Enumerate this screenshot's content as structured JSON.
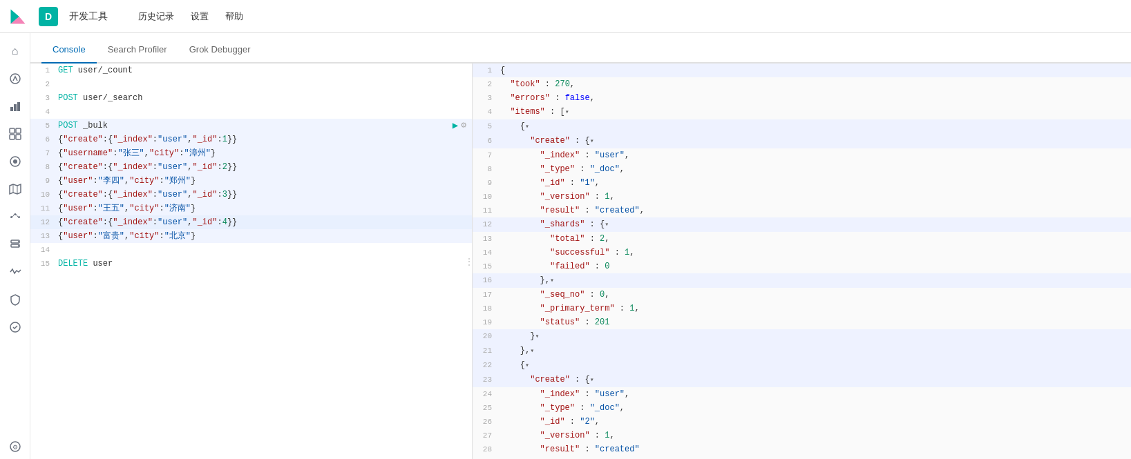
{
  "topbar": {
    "logo_text": "K",
    "app_icon": "D",
    "app_title": "开发工具"
  },
  "nav": {
    "items": [
      "历史记录",
      "设置",
      "帮助"
    ]
  },
  "tabs": {
    "items": [
      "Console",
      "Search Profiler",
      "Grok Debugger"
    ],
    "active": 0
  },
  "sidebar": {
    "icons": [
      {
        "name": "home-icon",
        "symbol": "⌂"
      },
      {
        "name": "bar-chart-icon",
        "symbol": "▦"
      },
      {
        "name": "stack-icon",
        "symbol": "⊞"
      },
      {
        "name": "box-icon",
        "symbol": "⬡"
      },
      {
        "name": "person-icon",
        "symbol": "👤"
      },
      {
        "name": "nodes-icon",
        "symbol": "⬡"
      },
      {
        "name": "alert-icon",
        "symbol": "🔔"
      },
      {
        "name": "wrench-icon",
        "symbol": "🔧"
      },
      {
        "name": "refresh-icon",
        "symbol": "↺"
      },
      {
        "name": "lock-icon",
        "symbol": "🔒"
      },
      {
        "name": "heart-icon",
        "symbol": "♡"
      },
      {
        "name": "settings-icon",
        "symbol": "⚙"
      }
    ]
  },
  "editor": {
    "lines": [
      {
        "num": 1,
        "type": "get",
        "content": "GET user/_count"
      },
      {
        "num": 2,
        "type": "empty",
        "content": ""
      },
      {
        "num": 3,
        "type": "post",
        "content": "POST user/_search"
      },
      {
        "num": 4,
        "type": "empty",
        "content": ""
      },
      {
        "num": 5,
        "type": "post_bulk",
        "content": "POST _bulk",
        "has_actions": true
      },
      {
        "num": 6,
        "type": "json",
        "content": "{\"create\":{\"_index\":\"user\",\"_id\":1}}"
      },
      {
        "num": 7,
        "type": "json",
        "content": "{\"username\":\"张三\",\"city\":\"漳州\"}"
      },
      {
        "num": 8,
        "type": "json",
        "content": "{\"create\":{\"_index\":\"user\",\"_id\":2}}"
      },
      {
        "num": 9,
        "type": "json",
        "content": "{\"user\":\"李四\",\"city\":\"郑州\"}"
      },
      {
        "num": 10,
        "type": "json",
        "content": "{\"create\":{\"_index\":\"user\",\"_id\":3}}"
      },
      {
        "num": 11,
        "type": "json",
        "content": "{\"user\":\"王五\",\"city\":\"济南\"}"
      },
      {
        "num": 12,
        "type": "json_selected",
        "content": "{\"create\":{\"_index\":\"user\",\"_id\":4}}"
      },
      {
        "num": 13,
        "type": "json",
        "content": "{\"user\":\"富贵\",\"city\":\"北京\"}"
      },
      {
        "num": 14,
        "type": "empty",
        "content": ""
      },
      {
        "num": 15,
        "type": "delete",
        "content": "DELETE user"
      }
    ]
  },
  "result": {
    "lines": [
      {
        "num": 1,
        "content": "{",
        "fold": false,
        "highlighted": true
      },
      {
        "num": 2,
        "content": "  \"took\" : 270,"
      },
      {
        "num": 3,
        "content": "  \"errors\" : false,"
      },
      {
        "num": 4,
        "content": "  \"items\" : [",
        "fold": true
      },
      {
        "num": 5,
        "content": "    {",
        "fold": true,
        "highlighted": true
      },
      {
        "num": 6,
        "content": "      \"create\" : {",
        "fold": true,
        "highlighted": true
      },
      {
        "num": 7,
        "content": "        \"_index\" : \"user\","
      },
      {
        "num": 8,
        "content": "        \"_type\" : \"_doc\","
      },
      {
        "num": 9,
        "content": "        \"_id\" : \"1\","
      },
      {
        "num": 10,
        "content": "        \"_version\" : 1,"
      },
      {
        "num": 11,
        "content": "        \"result\" : \"created\","
      },
      {
        "num": 12,
        "content": "        \"_shards\" : {",
        "fold": true,
        "highlighted": true
      },
      {
        "num": 13,
        "content": "          \"total\" : 2,"
      },
      {
        "num": 14,
        "content": "          \"successful\" : 1,"
      },
      {
        "num": 15,
        "content": "          \"failed\" : 0"
      },
      {
        "num": 16,
        "content": "        },",
        "fold": true,
        "highlighted": true
      },
      {
        "num": 17,
        "content": "        \"_seq_no\" : 0,"
      },
      {
        "num": 18,
        "content": "        \"_primary_term\" : 1,"
      },
      {
        "num": 19,
        "content": "        \"status\" : 201"
      },
      {
        "num": 20,
        "content": "      }",
        "fold": true,
        "highlighted": true
      },
      {
        "num": 21,
        "content": "    },",
        "fold": true,
        "highlighted": true
      },
      {
        "num": 22,
        "content": "    {",
        "fold": true,
        "highlighted": true
      },
      {
        "num": 23,
        "content": "      \"create\" : {",
        "fold": true,
        "highlighted": true
      },
      {
        "num": 24,
        "content": "        \"_index\" : \"user\","
      },
      {
        "num": 25,
        "content": "        \"_type\" : \"_doc\","
      },
      {
        "num": 26,
        "content": "        \"_id\" : \"2\","
      },
      {
        "num": 27,
        "content": "        \"_version\" : 1,"
      },
      {
        "num": 28,
        "content": "        \"result\" : \"created\""
      }
    ]
  }
}
